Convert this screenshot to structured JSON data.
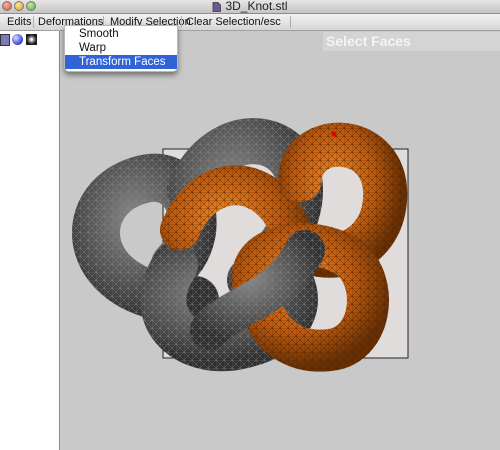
{
  "window": {
    "title": "3D_Knot.stl"
  },
  "menubar": {
    "items": [
      "Edits",
      "Deformations",
      "Modify Selection",
      "Clear Selection/esc"
    ]
  },
  "dropdown": {
    "items": [
      {
        "label": "Smooth",
        "highlighted": false
      },
      {
        "label": "Warp",
        "highlighted": false
      },
      {
        "label": "Transform Faces",
        "highlighted": true
      }
    ]
  },
  "viewport": {
    "mode_label": "Select Faces"
  },
  "colors": {
    "background": "#c9c9c9",
    "mesh_unselected": "#5a5a5a",
    "mesh_selected": "#c4620f",
    "menu_highlight": "#2f63d6"
  },
  "icons": [
    "document-icon",
    "close-icon",
    "minimize-icon",
    "zoom-icon",
    "select-mode-icon",
    "sphere-icon",
    "square-icon"
  ]
}
